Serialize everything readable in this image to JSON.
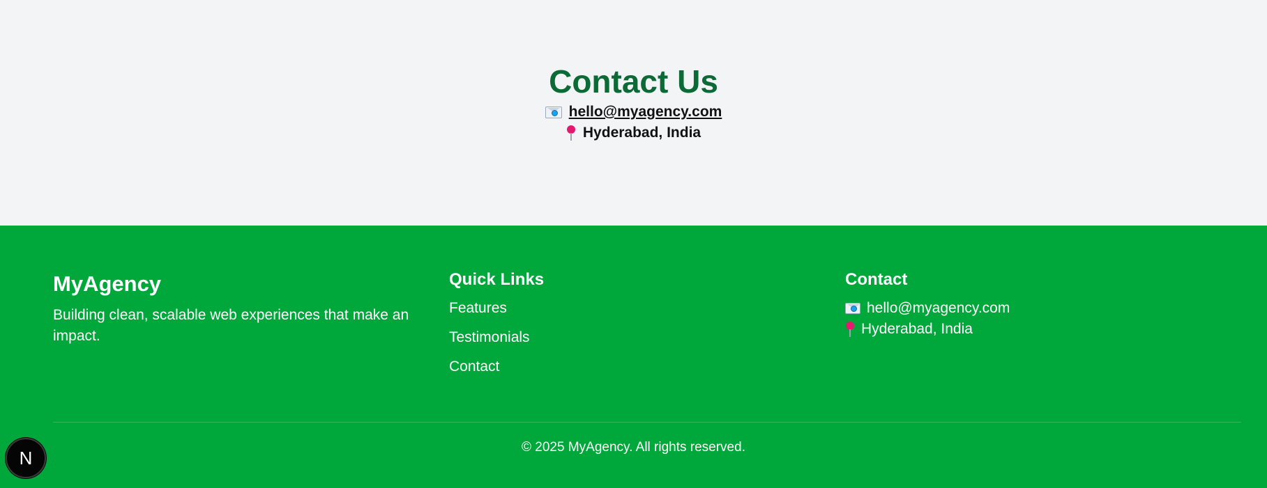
{
  "contact": {
    "title": "Contact Us",
    "email": "hello@myagency.com",
    "location": "Hyderabad, India"
  },
  "footer": {
    "brand": {
      "name": "MyAgency",
      "description": "Building clean, scalable web experiences that make an impact."
    },
    "quick_links": {
      "heading": "Quick Links",
      "items": [
        "Features",
        "Testimonials",
        "Contact"
      ]
    },
    "contact": {
      "heading": "Contact",
      "email": "hello@myagency.com",
      "location": "Hyderabad, India"
    },
    "copyright": "© 2025 MyAgency. All rights reserved."
  },
  "dev_badge": {
    "letter": "N"
  },
  "colors": {
    "footer_bg": "#00a83b",
    "title_green": "#0b6a35",
    "section_bg": "#f3f4f6"
  },
  "icons": {
    "email": "envelope-icon",
    "location": "pushpin-icon"
  }
}
